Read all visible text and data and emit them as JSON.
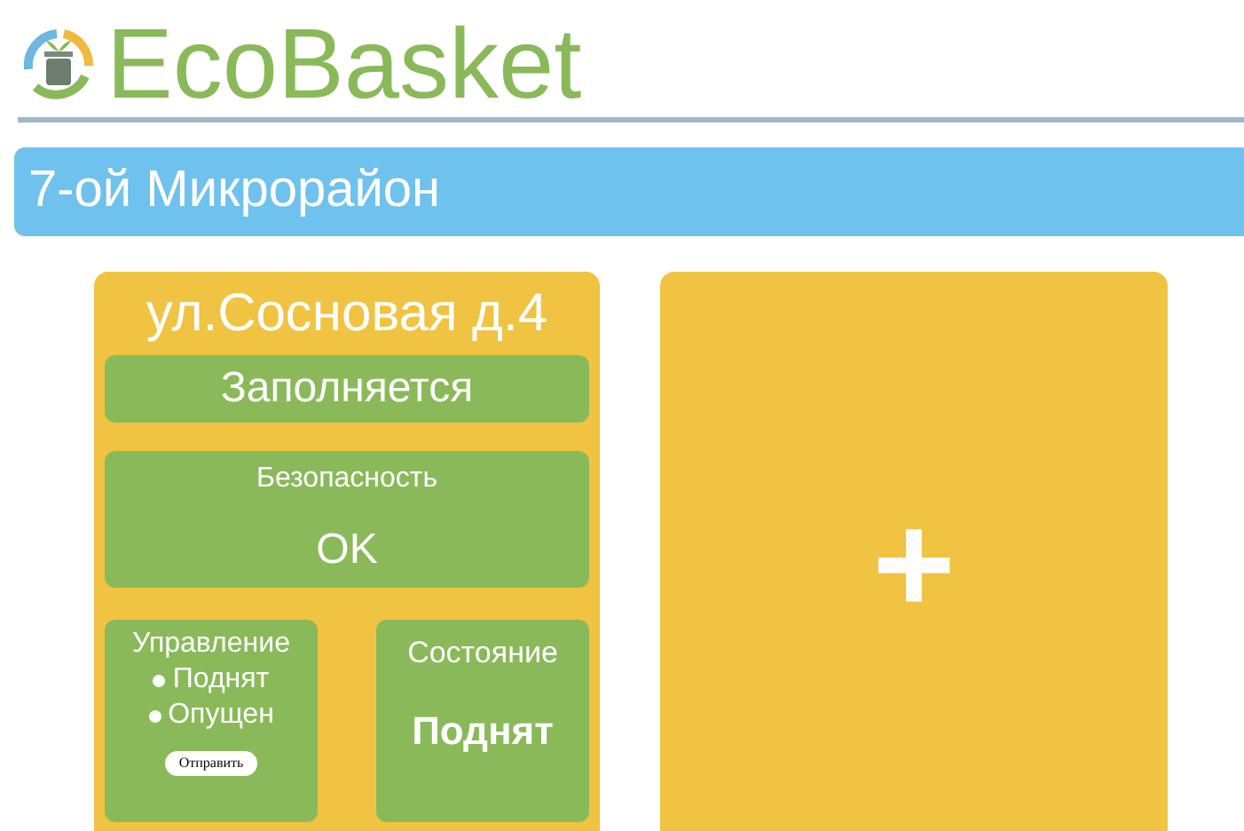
{
  "logo": {
    "text": "EcoBasket"
  },
  "district": {
    "title": "7-ой Микрорайон"
  },
  "bins": [
    {
      "address": "ул.Сосновая д.4",
      "fill_status": "Заполняется",
      "safety": {
        "label": "Безопасность",
        "value": "OK"
      },
      "control": {
        "label": "Управление",
        "options": [
          {
            "label": "Поднят",
            "selected": false
          },
          {
            "label": "Опущен",
            "selected": false
          }
        ],
        "button": "Отправить"
      },
      "state": {
        "label": "Состояние",
        "value": "Поднят"
      }
    }
  ],
  "add_card": {
    "symbol": "+"
  }
}
